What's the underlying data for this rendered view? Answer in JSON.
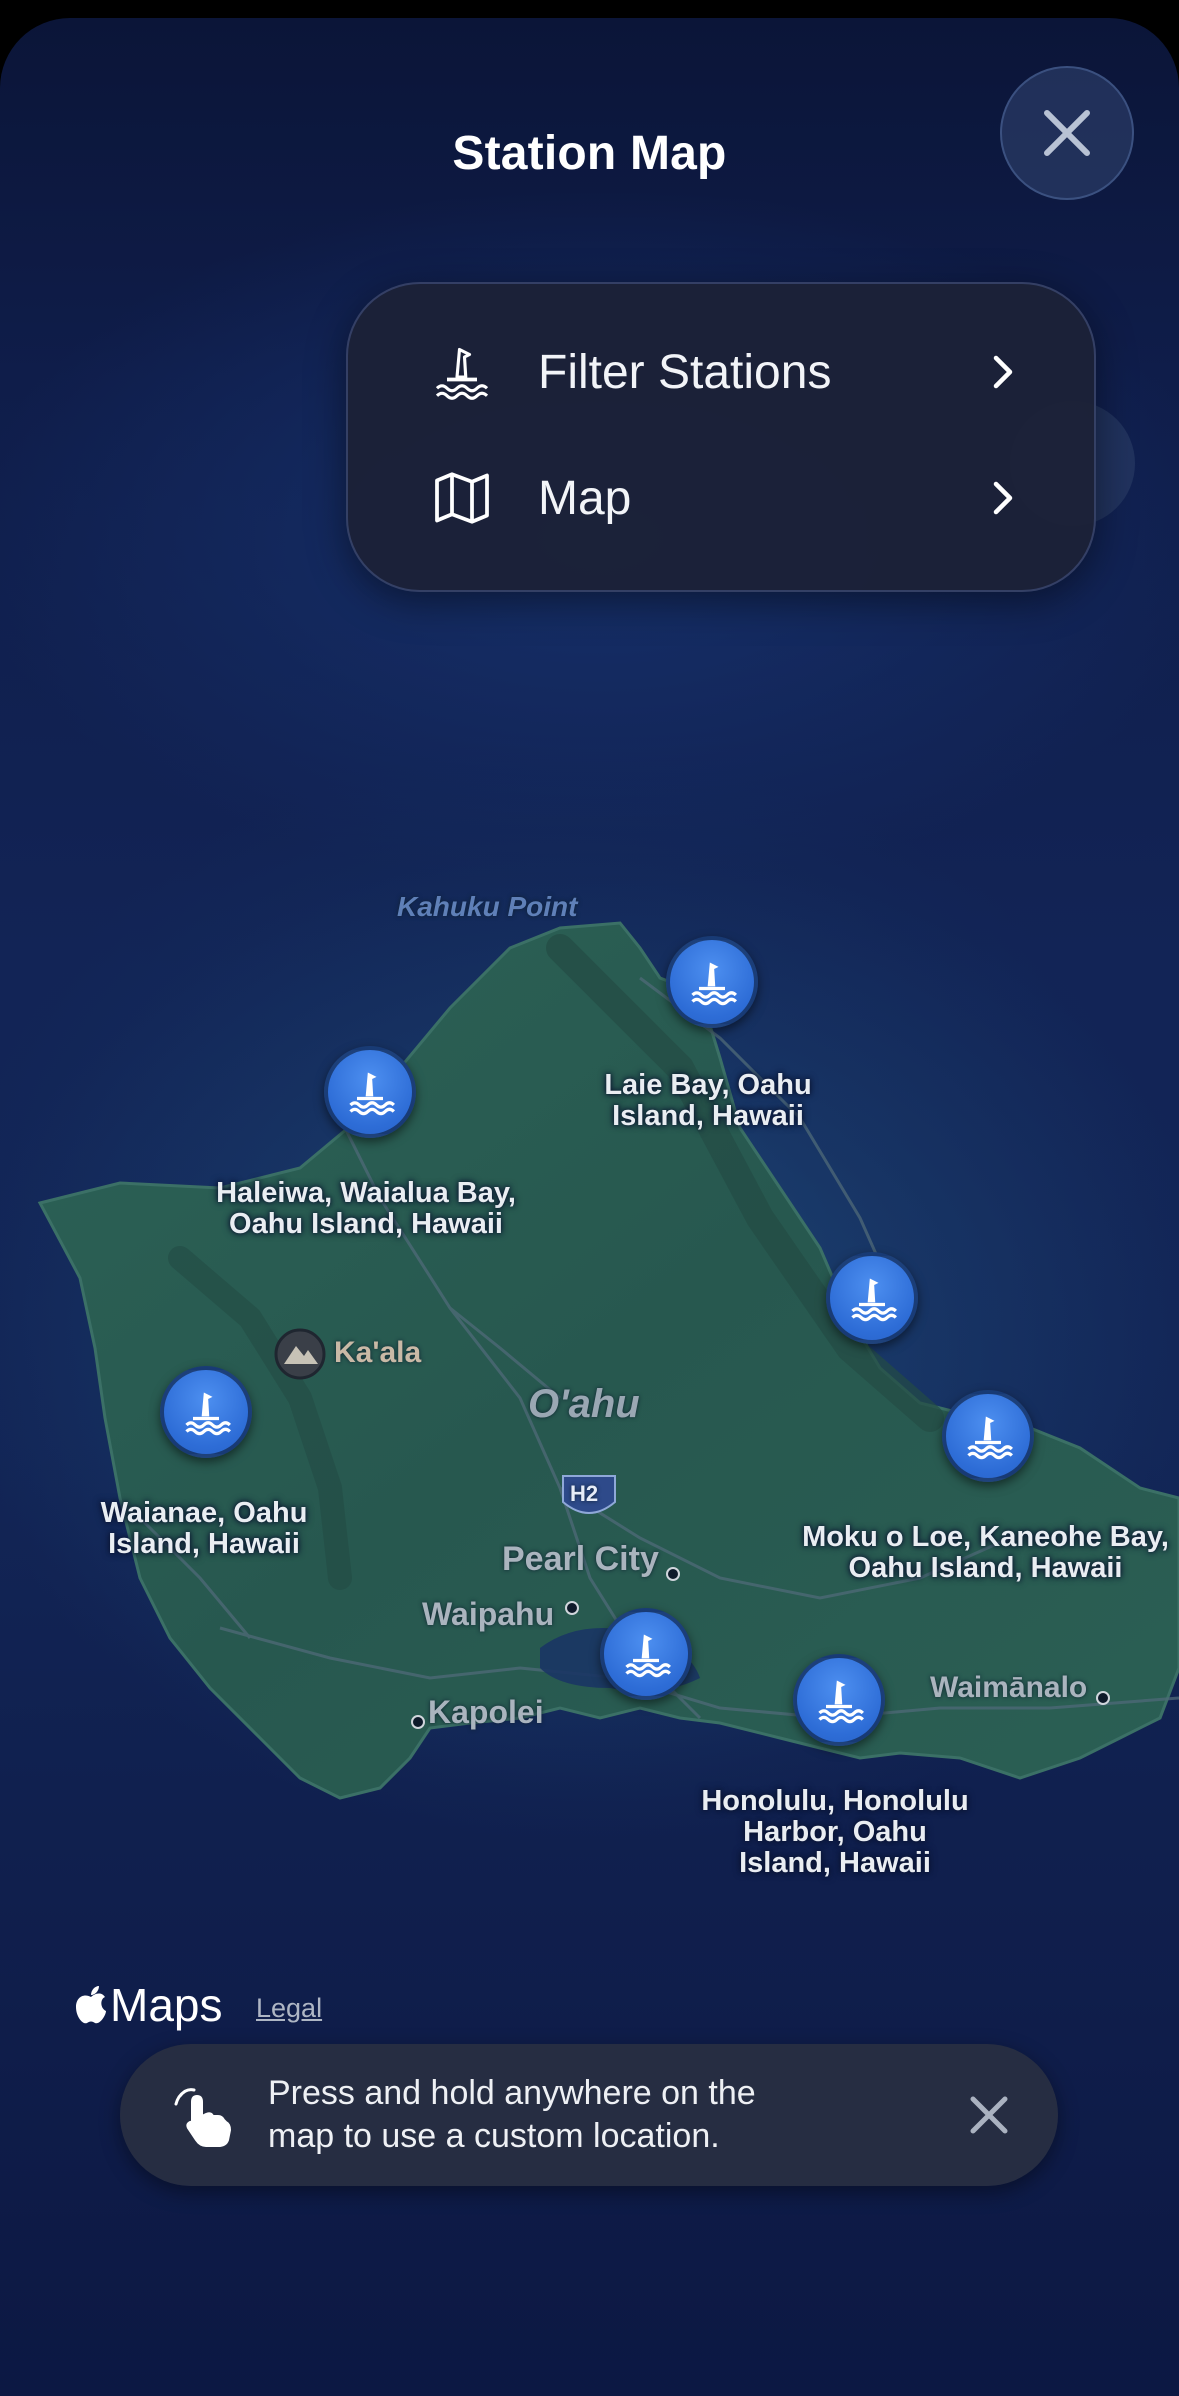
{
  "header": {
    "title": "Station Map"
  },
  "menu": {
    "items": [
      {
        "label": "Filter Stations",
        "icon": "buoy-icon"
      },
      {
        "label": "Map",
        "icon": "map-icon"
      }
    ]
  },
  "map": {
    "region_label": "O'ahu",
    "places": {
      "kahuku": "Kahuku Point",
      "kaala": "Ka'ala",
      "pearl_city": "Pearl City",
      "waipahu": "Waipahu",
      "kapolei": "Kapolei",
      "waimanalo": "Waimānalo",
      "highway": "H2"
    },
    "stations": [
      {
        "name": "Laie Bay, Oahu Island, Hawaii",
        "line1": "Laie Bay, Oahu",
        "line2": "Island, Hawaii"
      },
      {
        "name": "Haleiwa, Waialua Bay, Oahu Island, Hawaii",
        "line1": "Haleiwa, Waialua Bay,",
        "line2": "Oahu Island, Hawaii"
      },
      {
        "name": "Waianae, Oahu Island, Hawaii",
        "line1": "Waianae, Oahu",
        "line2": "Island, Hawaii"
      },
      {
        "name": "Moku o Loe, Kaneohe Bay, Oahu Island, Hawaii",
        "line1": "Moku o Loe, Kaneohe Bay,",
        "line2": "Oahu Island, Hawaii"
      },
      {
        "name": "Honolulu, Honolulu Harbor, Oahu Island, Hawaii",
        "line1": "Honolulu, Honolulu",
        "line2": "Harbor, Oahu",
        "line3": "Island, Hawaii"
      }
    ],
    "attribution": {
      "brand": "Maps",
      "legal": "Legal"
    }
  },
  "toast": {
    "line1": "Press and hold anywhere on the",
    "line2": "map to use a custom location."
  },
  "colors": {
    "accent": "#2f6fd9",
    "land": "#2a5a52",
    "ocean": "#122556"
  }
}
